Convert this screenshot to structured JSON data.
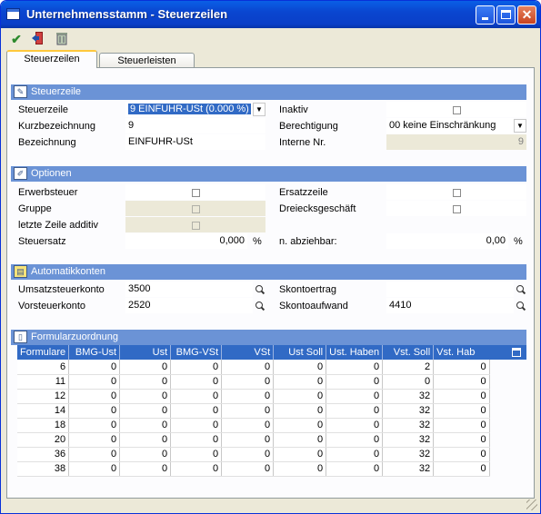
{
  "window": {
    "title": "Unternehmensstamm - Steuerzeilen"
  },
  "toolbar": {
    "icons": [
      "checkmark-icon",
      "exit-icon",
      "delete-icon"
    ]
  },
  "tabs": [
    {
      "label": "Steuerzeilen"
    },
    {
      "label": "Steuerleisten"
    }
  ],
  "sections": {
    "steuerzeile": "Steuerzeile",
    "optionen": "Optionen",
    "automatikkonten": "Automatikkonten",
    "formularzuordnung": "Formularzuordnung"
  },
  "steuerzeile": {
    "steuerzeile_label": "Steuerzeile",
    "steuerzeile_value": "9   EINFUHR-USt (0.000 %)",
    "inaktiv_label": "Inaktiv",
    "kurzbezeichnung_label": "Kurzbezeichnung",
    "kurzbezeichnung_value": "9",
    "berechtigung_label": "Berechtigung",
    "berechtigung_value": "00 keine Einschränkung",
    "bezeichnung_label": "Bezeichnung",
    "bezeichnung_value": "EINFUHR-USt",
    "interne_nr_label": "Interne Nr.",
    "interne_nr_value": "9"
  },
  "optionen": {
    "erwerbsteuer_label": "Erwerbsteuer",
    "ersatzzeile_label": "Ersatzzeile",
    "gruppe_label": "Gruppe",
    "dreiecksgeschaeft_label": "Dreiecksgeschäft",
    "letzte_zeile_label": "letzte Zeile additiv",
    "steuersatz_label": "Steuersatz",
    "steuersatz_value": "0,000",
    "steuersatz_unit": "%",
    "n_abziehbar_label": "n. abziehbar:",
    "n_abziehbar_value": "0,00",
    "n_abziehbar_unit": "%"
  },
  "automatikkonten": {
    "umsatzsteuerkonto_label": "Umsatzsteuerkonto",
    "umsatzsteuerkonto_value": "3500",
    "skontoertrag_label": "Skontoertrag",
    "skontoertrag_value": "",
    "vorsteuerkonto_label": "Vorsteuerkonto",
    "vorsteuerkonto_value": "2520",
    "skontoaufwand_label": "Skontoaufwand",
    "skontoaufwand_value": "4410"
  },
  "grid": {
    "headers": [
      "Formulare",
      "BMG-Ust",
      "Ust",
      "BMG-VSt",
      "VSt",
      "Ust Soll",
      "Ust. Haben",
      "Vst. Soll",
      "Vst. Haben"
    ],
    "rows": [
      [
        "6",
        "0",
        "0",
        "0",
        "0",
        "0",
        "0",
        "2",
        "0"
      ],
      [
        "11",
        "0",
        "0",
        "0",
        "0",
        "0",
        "0",
        "0",
        "0"
      ],
      [
        "12",
        "0",
        "0",
        "0",
        "0",
        "0",
        "0",
        "32",
        "0"
      ],
      [
        "14",
        "0",
        "0",
        "0",
        "0",
        "0",
        "0",
        "32",
        "0"
      ],
      [
        "18",
        "0",
        "0",
        "0",
        "0",
        "0",
        "0",
        "32",
        "0"
      ],
      [
        "20",
        "0",
        "0",
        "0",
        "0",
        "0",
        "0",
        "32",
        "0"
      ],
      [
        "36",
        "0",
        "0",
        "0",
        "0",
        "0",
        "0",
        "32",
        "0"
      ],
      [
        "38",
        "0",
        "0",
        "0",
        "0",
        "0",
        "0",
        "32",
        "0"
      ]
    ]
  }
}
